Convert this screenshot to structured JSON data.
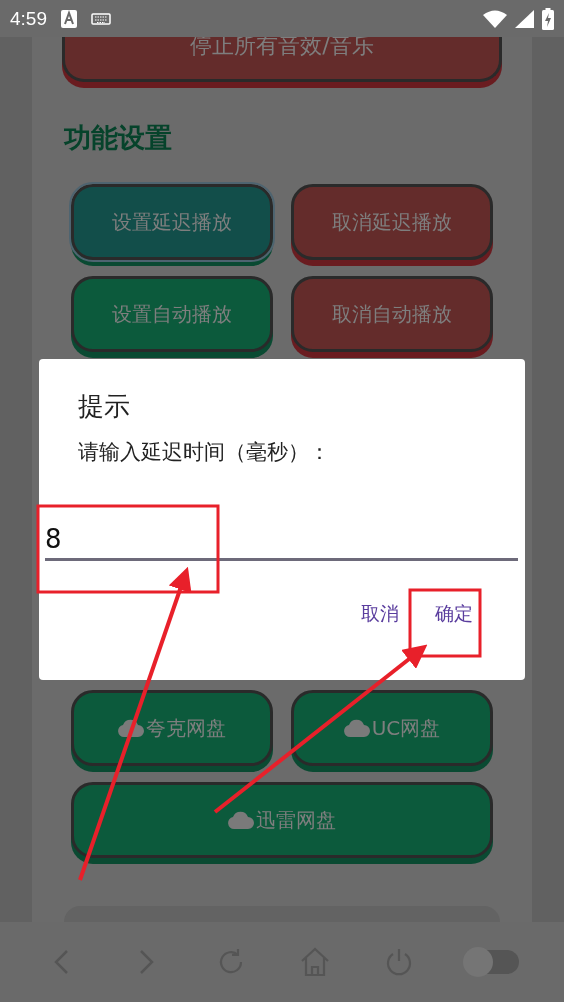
{
  "status_bar": {
    "time": "4:59"
  },
  "stop_button": {
    "label": "停止所有音效/音乐",
    "kind": "stop"
  },
  "section_title": "功能设置",
  "buttons_top": [
    {
      "label": "设置延迟播放",
      "kind": "start",
      "selected": true
    },
    {
      "label": "取消延迟播放",
      "kind": "stop",
      "selected": false
    },
    {
      "label": "设置自动播放",
      "kind": "start",
      "selected": false
    },
    {
      "label": "取消自动播放",
      "kind": "stop",
      "selected": false
    }
  ],
  "buttons_bottom": [
    {
      "label": "夸克网盘",
      "kind": "drive",
      "selected": false
    },
    {
      "label": "UC网盘",
      "kind": "drive",
      "selected": false
    },
    {
      "label": "迅雷网盘",
      "kind": "drive",
      "selected": false
    }
  ],
  "dialog": {
    "title": "提示",
    "message": "请输入延迟时间（毫秒）：",
    "value": "8",
    "buttons": [
      "取消",
      "确定"
    ]
  },
  "nav_bar": {
    "toggle": {
      "on": false
    }
  }
}
